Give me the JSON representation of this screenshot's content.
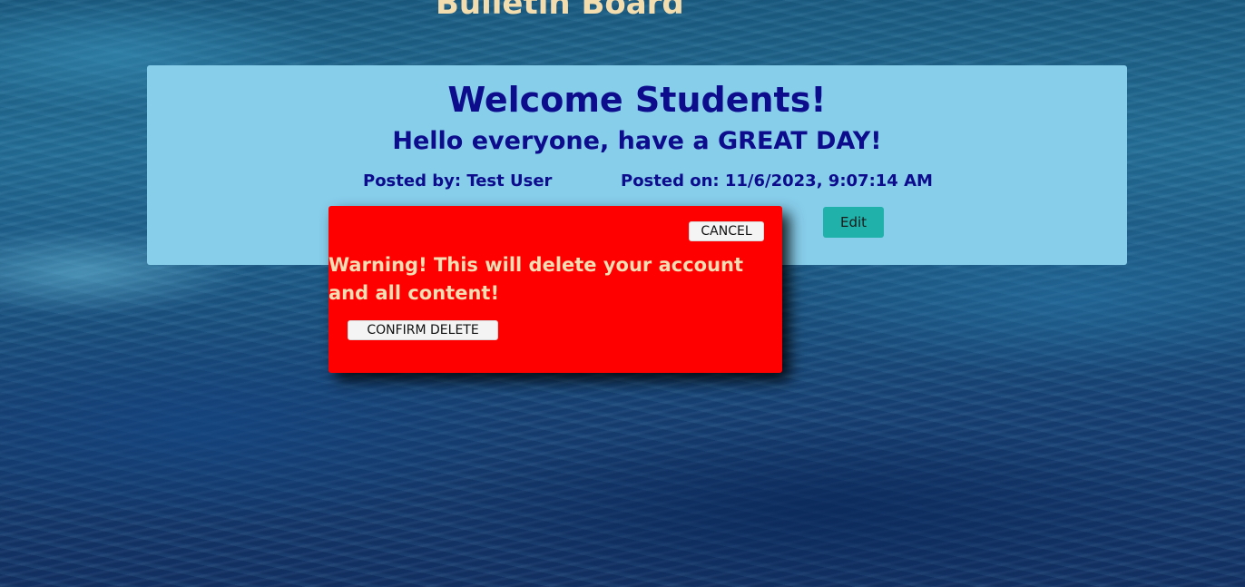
{
  "header": {
    "title": "Bulletin Board"
  },
  "post": {
    "title": "Welcome Students!",
    "body": "Hello everyone, have a GREAT DAY!",
    "posted_by": "Posted by: Test User",
    "posted_on": "Posted on: 11/6/2023, 9:07:14 AM",
    "edit_label": "Edit"
  },
  "modal": {
    "cancel_label": "CANCEL",
    "warning": "Warning! This will delete your account and all content!",
    "confirm_label": "CONFIRM DELETE"
  },
  "colors": {
    "card_background": "#87ceeb",
    "card_text": "#0c0c8c",
    "title_text": "#f3dcae",
    "edit_button": "#20b2aa",
    "modal_background": "#ff0000",
    "warning_text": "#f5deb3"
  }
}
